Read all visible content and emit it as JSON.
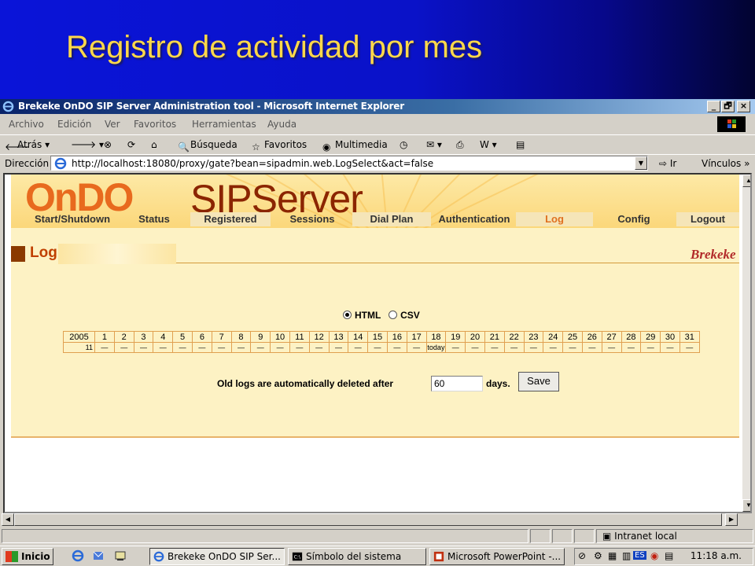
{
  "slide": {
    "title": "Registro de actividad por mes"
  },
  "window": {
    "title": "Brekeke OnDO SIP Server Administration tool - Microsoft Internet Explorer",
    "controls": {
      "minimize": "_",
      "maximize": "🗗",
      "close": "×"
    }
  },
  "menu": [
    "Archivo",
    "Edición",
    "Ver",
    "Favoritos",
    "Herramientas",
    "Ayuda"
  ],
  "toolbar": {
    "back": "Atrás",
    "search": "Búsqueda",
    "favorites": "Favoritos",
    "media": "Multimedia"
  },
  "address": {
    "label": "Dirección",
    "url": "http://localhost:18080/proxy/gate?bean=sipadmin.web.LogSelect&act=false",
    "go": "Ir",
    "links": "Vínculos"
  },
  "app": {
    "logo_left": "OnDO",
    "logo_right": "SIPServer",
    "nav": [
      "Start/Shutdown",
      "Status",
      "Registered",
      "Sessions",
      "Dial Plan",
      "Authentication",
      "Log",
      "Config",
      "Logout"
    ],
    "section_title": "Log",
    "brand": "Brekeke",
    "format_options": [
      "HTML",
      "CSV"
    ],
    "selected_format": "HTML",
    "calendar": {
      "year": "2005",
      "month": "11",
      "days": [
        "1",
        "2",
        "3",
        "4",
        "5",
        "6",
        "7",
        "8",
        "9",
        "10",
        "11",
        "12",
        "13",
        "14",
        "15",
        "16",
        "17",
        "18",
        "19",
        "20",
        "21",
        "22",
        "23",
        "24",
        "25",
        "26",
        "27",
        "28",
        "29",
        "30",
        "31"
      ],
      "cells": [
        "—",
        "—",
        "—",
        "—",
        "—",
        "—",
        "—",
        "—",
        "—",
        "—",
        "—",
        "—",
        "—",
        "—",
        "—",
        "—",
        "—",
        "today",
        "—",
        "—",
        "—",
        "—",
        "—",
        "—",
        "—",
        "—",
        "—",
        "—",
        "—",
        "—",
        "—"
      ]
    },
    "retention_text": "Old logs are automatically deleted after",
    "retention_value": "60",
    "retention_unit": "days.",
    "save_label": "Save"
  },
  "status": {
    "zone": "Intranet local"
  },
  "taskbar": {
    "start": "Inicio",
    "tasks": [
      {
        "label": "Brekeke OnDO SIP Ser..."
      },
      {
        "label": "Símbolo del sistema"
      },
      {
        "label": "Microsoft PowerPoint -..."
      }
    ],
    "language": "ES",
    "clock": "11:18 a.m."
  }
}
